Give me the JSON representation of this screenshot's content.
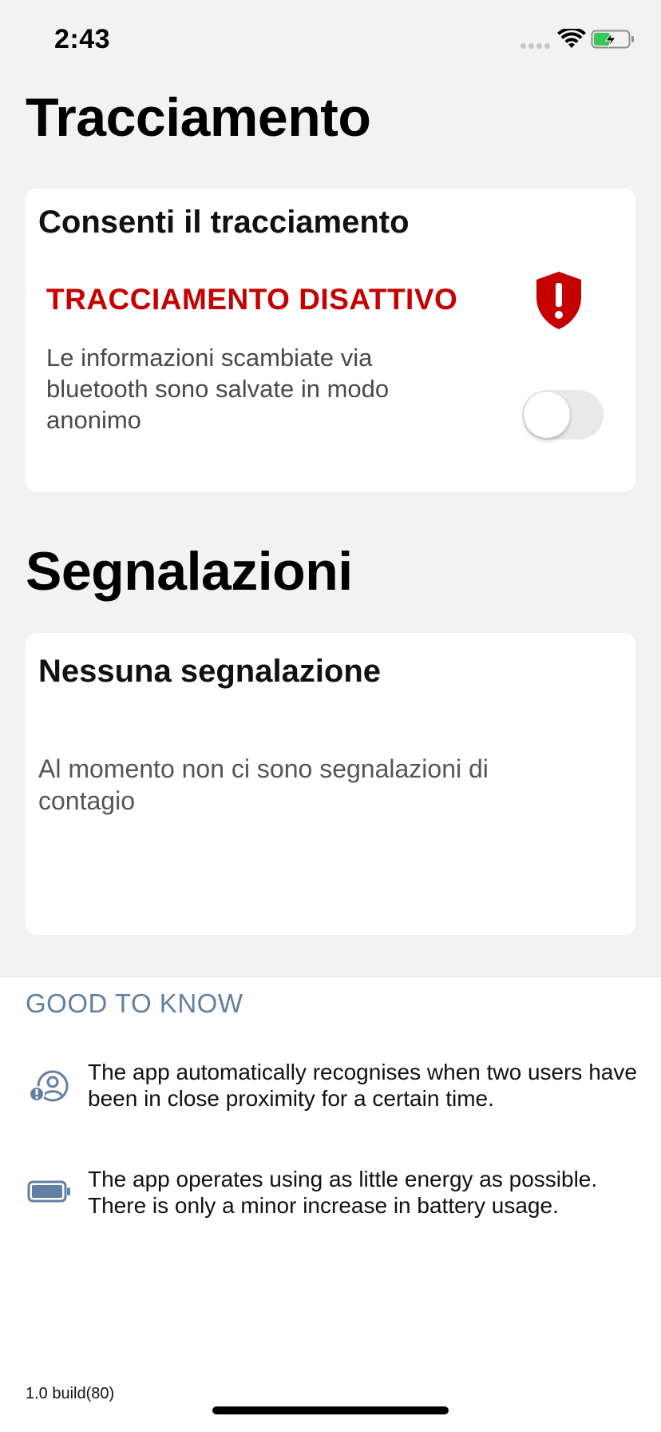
{
  "status_bar": {
    "time": "2:43"
  },
  "tracking": {
    "section_title": "Tracciamento",
    "card_title": "Consenti il tracciamento",
    "status_text": "TRACCIAMENTO DISATTIVO",
    "description": "Le informazioni scambiate via bluetooth sono salvate in modo anonimo",
    "toggle_on": false,
    "status_color": "#c40000"
  },
  "reports": {
    "section_title": "Segnalazioni",
    "card_title": "Nessuna segnalazione",
    "empty_message": "Al momento non ci sono segnalazioni di contagio"
  },
  "good_to_know": {
    "heading": "GOOD TO KNOW",
    "items": [
      {
        "icon": "user-proximity-icon",
        "text": "The app automatically recognises when two users have been in close proximity for a certain time."
      },
      {
        "icon": "battery-icon",
        "text": "The app operates using as little energy as possible. There is only a minor increase in battery usage."
      }
    ],
    "accent_color": "#627fa3"
  },
  "footer": {
    "version": "1.0 build(80)"
  }
}
